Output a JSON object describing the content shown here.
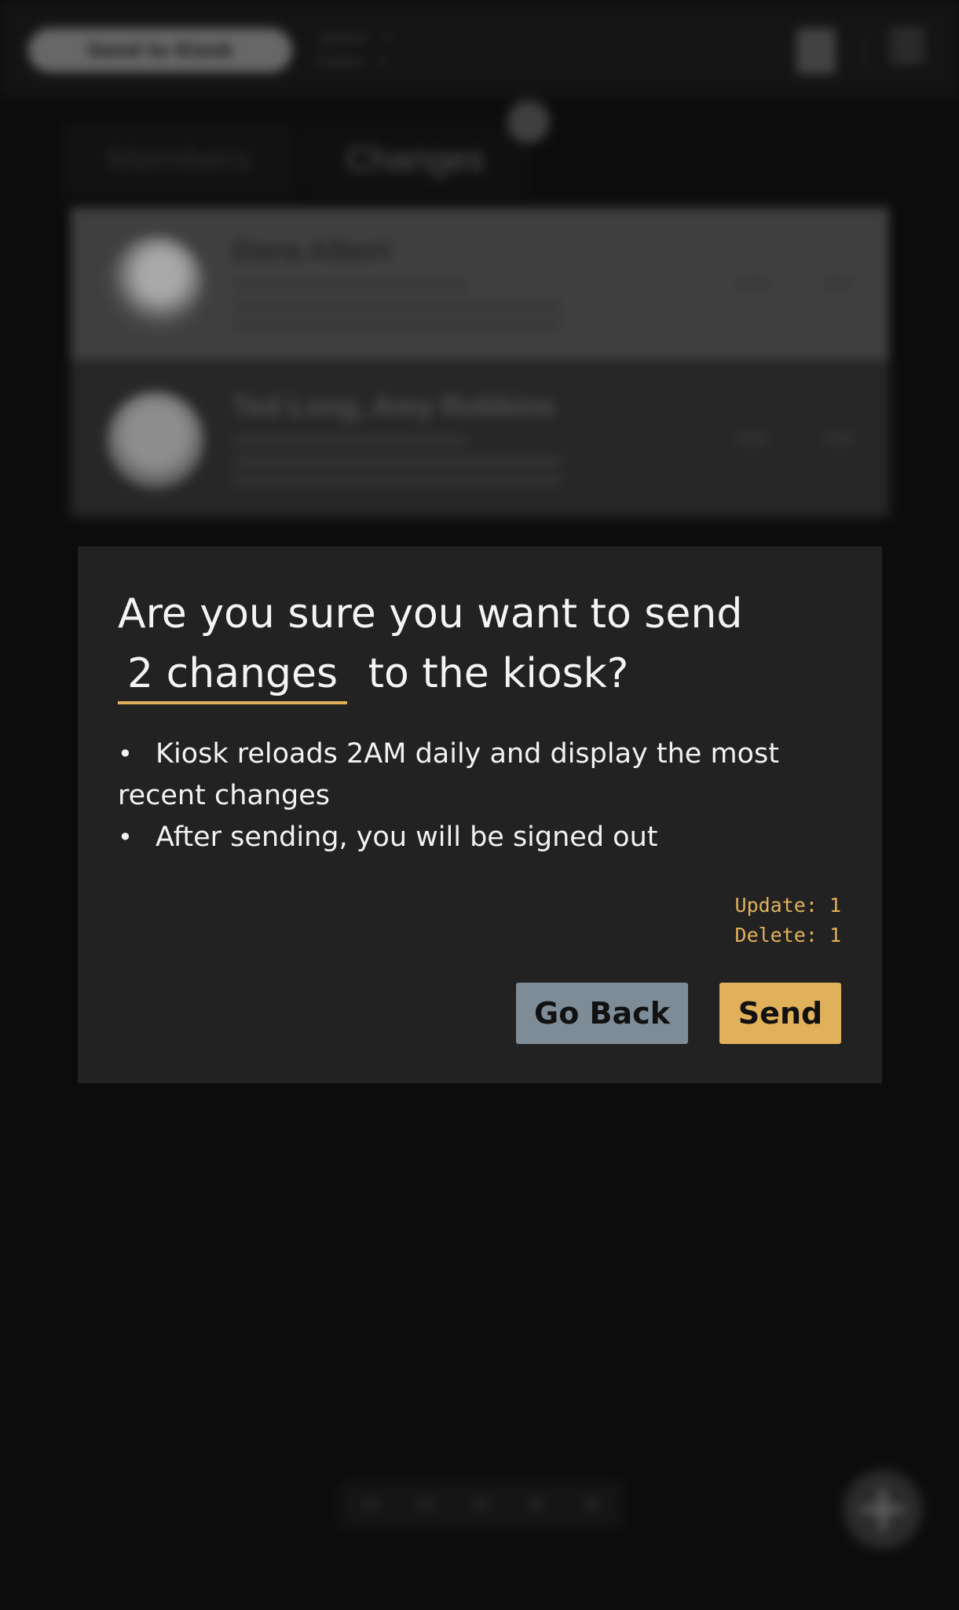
{
  "background": {
    "header": {
      "send_button_label": "Send to Kiosk",
      "update_label": "Update",
      "update_count": "1",
      "delete_label": "Delete",
      "delete_count": "1",
      "doc_icon": "document-icon",
      "menu_icon": "menu-icon"
    },
    "tabs": [
      {
        "label": "Members"
      },
      {
        "label": "Changes"
      }
    ],
    "changes_badge": "2",
    "cards": [
      {
        "name": "Dana Albert",
        "action_left": "Edit",
        "action_right": "Del"
      },
      {
        "name": "Ted Long, Amy Robbins",
        "action_left": "Edit",
        "action_right": "Del"
      }
    ],
    "fab_icon": "plus-icon"
  },
  "modal": {
    "question_prefix": "Are you sure you want to send",
    "changes_count_text": "2 changes",
    "question_suffix": "to the kiosk?",
    "bullets": [
      "Kiosk reloads 2AM daily and display the most recent changes",
      "After sending, you will be signed out"
    ],
    "summary": {
      "update": "Update: 1",
      "delete": "Delete: 1"
    },
    "buttons": {
      "go_back": "Go Back",
      "send": "Send"
    },
    "accent_color": "#e0b15a",
    "secondary_button_color": "#7e8c97"
  }
}
